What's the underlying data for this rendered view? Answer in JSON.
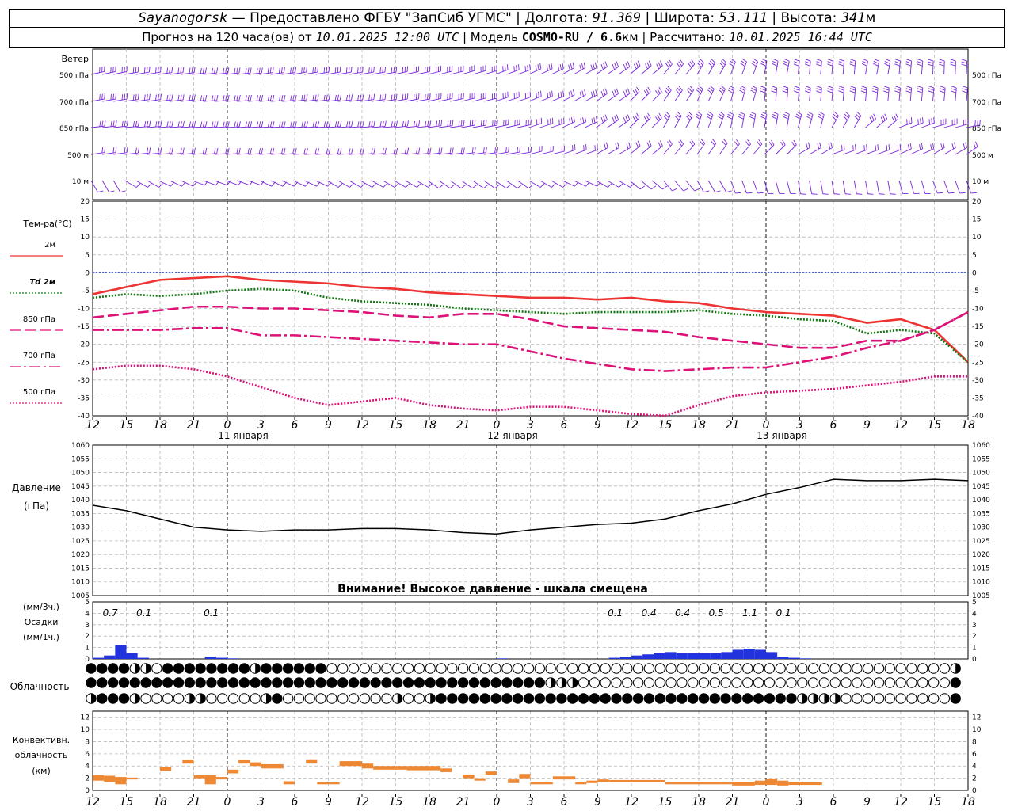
{
  "header": {
    "station": "Sayanogorsk",
    "dash": " — ",
    "provided": "Предоставлено ФГБУ \"ЗапСиб УГМС\"",
    "lon_label": "Долгота:",
    "lon": "91.369",
    "lat_label": "Широта:",
    "lat": "53.111",
    "alt_label": "Высота:",
    "alt": "341",
    "alt_unit": "м",
    "forecast_prefix": "Прогноз на 120 часа(ов) от",
    "forecast_run": "10.01.2025 12:00 UTC",
    "model_label": "Модель",
    "model": "COSMO-RU / 6.6",
    "model_unit": "км",
    "computed_label": "Рассчитано:",
    "computed": "10.01.2025 16:44 UTC"
  },
  "chart_data": [
    {
      "type": "wind-barbs",
      "label": "Ветер",
      "levels": [
        "500 гПа",
        "700 гПа",
        "850 гПа",
        "500 м",
        "10  м"
      ],
      "color": "#7a28d8"
    },
    {
      "type": "line",
      "ylabel": "Тем-ра(°C)",
      "ylim": [
        -40,
        20
      ],
      "yticks": [
        20,
        15,
        10,
        5,
        0,
        -5,
        -10,
        -15,
        -20,
        -25,
        -30,
        -35,
        -40
      ],
      "x_hours": [
        0,
        3,
        6,
        9,
        12,
        15,
        18,
        21,
        24,
        27,
        30,
        33,
        36,
        39,
        42,
        45,
        48,
        51,
        54,
        57,
        60,
        63,
        66,
        69,
        72,
        75,
        78
      ],
      "series": [
        {
          "name": "2м",
          "color": "#ee3333",
          "dash": "solid",
          "values": [
            -6,
            -4,
            -2,
            -1.5,
            -1,
            -2,
            -2.5,
            -3,
            -4,
            -4.5,
            -5.5,
            -6,
            -6.5,
            -7,
            -7,
            -7.5,
            -7,
            -8,
            -8.5,
            -10,
            -11,
            -11.5,
            -12,
            -14,
            -13,
            -16,
            -25
          ]
        },
        {
          "name": "Td 2м",
          "color": "#117711",
          "dash": "dot",
          "values": [
            -7,
            -6,
            -6.5,
            -6,
            -5,
            -4.5,
            -5,
            -7,
            -8,
            -8.5,
            -9,
            -10,
            -10.5,
            -11,
            -11.5,
            -11,
            -11,
            -11,
            -10.5,
            -11.5,
            -12,
            -13,
            -13.5,
            -17,
            -16,
            -17,
            -25
          ]
        },
        {
          "name": "850 гПа",
          "color": "#dd1177",
          "dash": "long",
          "values": [
            -12.5,
            -11.5,
            -10.5,
            -9.5,
            -9.5,
            -10,
            -10,
            -10.5,
            -11,
            -12,
            -12.5,
            -11.5,
            -11.5,
            -13,
            -15,
            -15.5,
            -16,
            -16.5,
            -18,
            -19,
            -20,
            -21,
            -21,
            -19,
            -19,
            -16,
            -11
          ]
        },
        {
          "name": "700 гПа",
          "color": "#dd1177",
          "dash": "dashdot",
          "values": [
            -16,
            -16,
            -16,
            -15.5,
            -15.5,
            -17.5,
            -17.5,
            -18,
            -18.5,
            -19,
            -19.5,
            -20,
            -20,
            -22,
            -24,
            -25.5,
            -27,
            -27.5,
            -27,
            -26.5,
            -26.5,
            -25,
            -23.5,
            -21,
            -19,
            -16,
            -11
          ]
        },
        {
          "name": "500 гПа",
          "color": "#dd1177",
          "dash": "dot",
          "values": [
            -27,
            -26,
            -26,
            -27,
            -29,
            -32,
            -35,
            -37,
            -36,
            -35,
            -37,
            -38,
            -38.5,
            -37.5,
            -37.5,
            -38.5,
            -39.5,
            -40,
            -37,
            -34.5,
            -33.5,
            -33,
            -32.5,
            -31.5,
            -30.5,
            -29,
            -29
          ]
        }
      ],
      "zero_line_color": "#3355dd"
    },
    {
      "type": "line",
      "ylabel": "Давление",
      "ylabel_unit": "(гПа)",
      "ylim": [
        1005,
        1060
      ],
      "yticks": [
        1060,
        1055,
        1050,
        1045,
        1040,
        1035,
        1030,
        1025,
        1020,
        1015,
        1010,
        1005
      ],
      "x_hours": [
        0,
        3,
        6,
        9,
        12,
        15,
        18,
        21,
        24,
        27,
        30,
        33,
        36,
        39,
        42,
        45,
        48,
        51,
        54,
        57,
        60,
        63,
        66,
        69,
        72,
        75,
        78
      ],
      "series": [
        {
          "name": "",
          "color": "#000000",
          "values": [
            1038,
            1036,
            1033,
            1030,
            1029,
            1028.5,
            1029,
            1029,
            1029.5,
            1029.5,
            1029,
            1028,
            1027.5,
            1029,
            1030,
            1031,
            1031.5,
            1033,
            1036,
            1038.5,
            1042,
            1044.5,
            1047.5,
            1047,
            1047,
            1047.5,
            1047
          ]
        }
      ],
      "note": "Внимание! Высокое давление - шкала смещена"
    },
    {
      "type": "bar",
      "ylabel_top": "(мм/3ч.)",
      "ylabel": "Осадки",
      "ylabel_bottom": "(мм/1ч.)",
      "ylim": [
        0,
        5
      ],
      "yticks": [
        5,
        4,
        3,
        2,
        1,
        0
      ],
      "color": "#2233dd",
      "labels3h": [
        {
          "hour": 1,
          "text": "0.7"
        },
        {
          "hour": 4,
          "text": "0.1"
        },
        {
          "hour": 10,
          "text": "0.1"
        },
        {
          "hour": 46,
          "text": "0.1"
        },
        {
          "hour": 49,
          "text": "0.4"
        },
        {
          "hour": 52,
          "text": "0.4"
        },
        {
          "hour": 55,
          "text": "0.5"
        },
        {
          "hour": 58,
          "text": "1.1"
        },
        {
          "hour": 61,
          "text": "0.1"
        }
      ],
      "hourly": [
        0.1,
        0.3,
        1.2,
        0.5,
        0.1,
        0,
        0,
        0,
        0,
        0,
        0.2,
        0.1,
        0.05,
        0,
        0,
        0,
        0,
        0,
        0,
        0,
        0,
        0,
        0,
        0,
        0,
        0,
        0,
        0,
        0,
        0,
        0,
        0,
        0,
        0,
        0,
        0,
        0.05,
        0,
        0,
        0,
        0,
        0,
        0,
        0,
        0,
        0,
        0.1,
        0.2,
        0.3,
        0.4,
        0.5,
        0.6,
        0.5,
        0.5,
        0.5,
        0.5,
        0.6,
        0.8,
        0.9,
        0.8,
        0.6,
        0.2,
        0.1,
        0.05,
        0,
        0,
        0,
        0,
        0,
        0,
        0,
        0,
        0,
        0,
        0,
        0,
        0,
        0
      ]
    },
    {
      "type": "cloud-cover",
      "label": "Облачность",
      "rows": [
        "FFFFQQEFFFFFFFFQFFFFFFEEEEEEEEEEEEEEEEEEEEEEEEEEEEEEEEEEEEEEEEEEEEEEEEEEEEEEEEEQ",
        "FFFFFFFFFFFFFFFFFFFFFFFFFFFFFFFFFFFFFFFFFFQQQEEEEEEEEEEEEEEEEEEEEEEEEEEEEEEEEEEF",
        "QFFFQEEEEQQEEEEEQFEEEEEEEEEEQEEQFFFFFFFFFFFFFFFFFFFFFFFFFFFFFFFFFQQQQEEEEEEEEEEF"
      ]
    },
    {
      "type": "bar",
      "ylabel": "Конвективн. облачность",
      "ylabel_unit": "(км)",
      "ylim": [
        0,
        13
      ],
      "yticks": [
        12,
        10,
        8,
        6,
        4,
        2,
        0
      ],
      "color": "#ee8833",
      "segments": [
        {
          "start": 0,
          "end": 1,
          "bottom": 1.6,
          "top": 2.5
        },
        {
          "start": 1,
          "end": 2,
          "bottom": 1.4,
          "top": 2.4
        },
        {
          "start": 2,
          "end": 3,
          "bottom": 1.0,
          "top": 2.2
        },
        {
          "start": 3,
          "end": 4,
          "bottom": 1.8,
          "top": 2.1
        },
        {
          "start": 6,
          "end": 7,
          "bottom": 3.2,
          "top": 3.9
        },
        {
          "start": 8,
          "end": 9,
          "bottom": 4.4,
          "top": 5.0
        },
        {
          "start": 9,
          "end": 10,
          "bottom": 2.0,
          "top": 2.5
        },
        {
          "start": 10,
          "end": 11,
          "bottom": 1.0,
          "top": 2.5
        },
        {
          "start": 11,
          "end": 12,
          "bottom": 1.8,
          "top": 2.2
        },
        {
          "start": 12,
          "end": 13,
          "bottom": 2.8,
          "top": 3.4
        },
        {
          "start": 13,
          "end": 14,
          "bottom": 4.4,
          "top": 5.0
        },
        {
          "start": 14,
          "end": 15,
          "bottom": 4.0,
          "top": 4.6
        },
        {
          "start": 15,
          "end": 17,
          "bottom": 3.6,
          "top": 4.3
        },
        {
          "start": 17,
          "end": 18,
          "bottom": 1.0,
          "top": 1.5
        },
        {
          "start": 19,
          "end": 20,
          "bottom": 4.4,
          "top": 5.1
        },
        {
          "start": 20,
          "end": 21,
          "bottom": 1.0,
          "top": 1.4
        },
        {
          "start": 21,
          "end": 22,
          "bottom": 1.0,
          "top": 1.3
        },
        {
          "start": 22,
          "end": 24,
          "bottom": 4.0,
          "top": 4.8
        },
        {
          "start": 24,
          "end": 25,
          "bottom": 3.6,
          "top": 4.4
        },
        {
          "start": 25,
          "end": 28,
          "bottom": 3.4,
          "top": 4.0
        },
        {
          "start": 28,
          "end": 31,
          "bottom": 3.3,
          "top": 4.0
        },
        {
          "start": 31,
          "end": 32,
          "bottom": 3.0,
          "top": 3.6
        },
        {
          "start": 33,
          "end": 34,
          "bottom": 2.0,
          "top": 2.6
        },
        {
          "start": 34,
          "end": 35,
          "bottom": 1.6,
          "top": 2.0
        },
        {
          "start": 35,
          "end": 36,
          "bottom": 2.6,
          "top": 3.1
        },
        {
          "start": 37,
          "end": 38,
          "bottom": 1.2,
          "top": 1.8
        },
        {
          "start": 38,
          "end": 39,
          "bottom": 2.0,
          "top": 2.7
        },
        {
          "start": 39,
          "end": 41,
          "bottom": 1.0,
          "top": 1.3
        },
        {
          "start": 41,
          "end": 43,
          "bottom": 1.8,
          "top": 2.3
        },
        {
          "start": 43,
          "end": 44,
          "bottom": 1.0,
          "top": 1.3
        },
        {
          "start": 44,
          "end": 45,
          "bottom": 1.2,
          "top": 1.6
        },
        {
          "start": 45,
          "end": 46,
          "bottom": 1.4,
          "top": 1.8
        },
        {
          "start": 46,
          "end": 51,
          "bottom": 1.4,
          "top": 1.7
        },
        {
          "start": 51,
          "end": 56,
          "bottom": 1.0,
          "top": 1.3
        },
        {
          "start": 56,
          "end": 57,
          "bottom": 1.0,
          "top": 1.3
        },
        {
          "start": 57,
          "end": 59,
          "bottom": 0.8,
          "top": 1.4
        },
        {
          "start": 59,
          "end": 60,
          "bottom": 0.9,
          "top": 1.6
        },
        {
          "start": 60,
          "end": 61,
          "bottom": 0.9,
          "top": 1.9
        },
        {
          "start": 61,
          "end": 62,
          "bottom": 0.8,
          "top": 1.6
        },
        {
          "start": 62,
          "end": 63,
          "bottom": 0.9,
          "top": 1.4
        },
        {
          "start": 63,
          "end": 65,
          "bottom": 0.9,
          "top": 1.3
        }
      ]
    }
  ],
  "time_axis": {
    "hours_total": 78,
    "ticks": [
      "12",
      "15",
      "18",
      "21",
      "0",
      "3",
      "6",
      "9",
      "12",
      "15",
      "18",
      "21",
      "0",
      "3",
      "6",
      "9",
      "12",
      "15",
      "18",
      "21",
      "0",
      "3",
      "6",
      "9",
      "12",
      "15",
      "18"
    ],
    "day_labels": [
      {
        "hour": 24,
        "text": "11 января"
      },
      {
        "hour": 48,
        "text": "12 января"
      },
      {
        "hour": 72,
        "text": "13 января"
      }
    ],
    "midnight_hours": [
      12,
      36,
      60
    ]
  }
}
